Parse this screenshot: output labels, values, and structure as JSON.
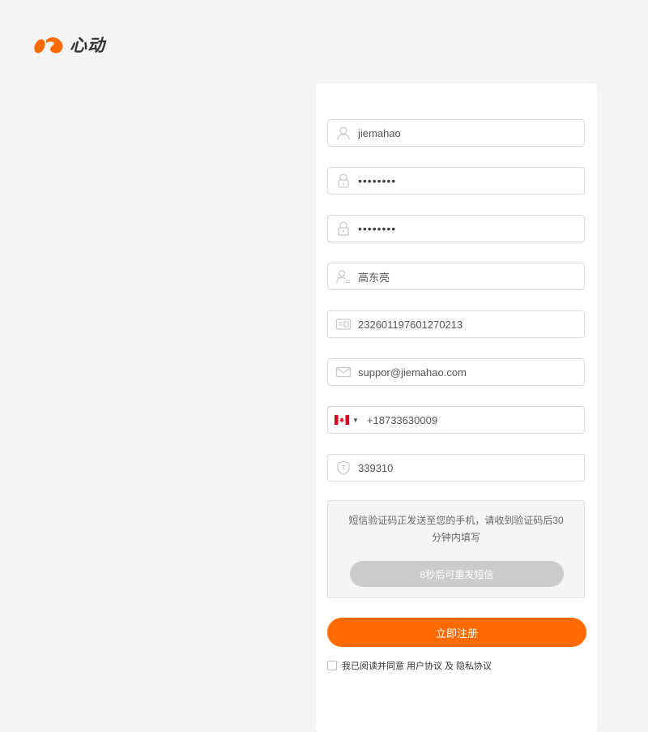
{
  "brand": {
    "name": "心动",
    "color": "#ff6a00"
  },
  "form": {
    "username": {
      "value": "jiemahao",
      "icon": "user-icon"
    },
    "password": {
      "value": "••••••••",
      "icon": "lock-icon"
    },
    "confirm_password": {
      "value": "••••••••",
      "icon": "lock-icon"
    },
    "real_name": {
      "value": "高东亮",
      "icon": "user-id-icon"
    },
    "id_number": {
      "value": "232601197601270213",
      "icon": "id-card-icon"
    },
    "email": {
      "value": "suppor@jiemahao.com",
      "icon": "mail-icon"
    },
    "phone": {
      "value": "+18733630009",
      "country": "canada-flag-icon"
    },
    "sms_code": {
      "value": "339310",
      "icon": "shield-icon"
    }
  },
  "sms_notice": {
    "text": "短信验证码正发送至您的手机，请收到验证码后30分钟内填写",
    "resend_label": "8秒后可重发短信"
  },
  "submit_label": "立即注册",
  "agreement": {
    "prefix": "我已阅读并同意",
    "user_agreement": "用户协议",
    "and": "及",
    "privacy_agreement": "隐私协议"
  }
}
